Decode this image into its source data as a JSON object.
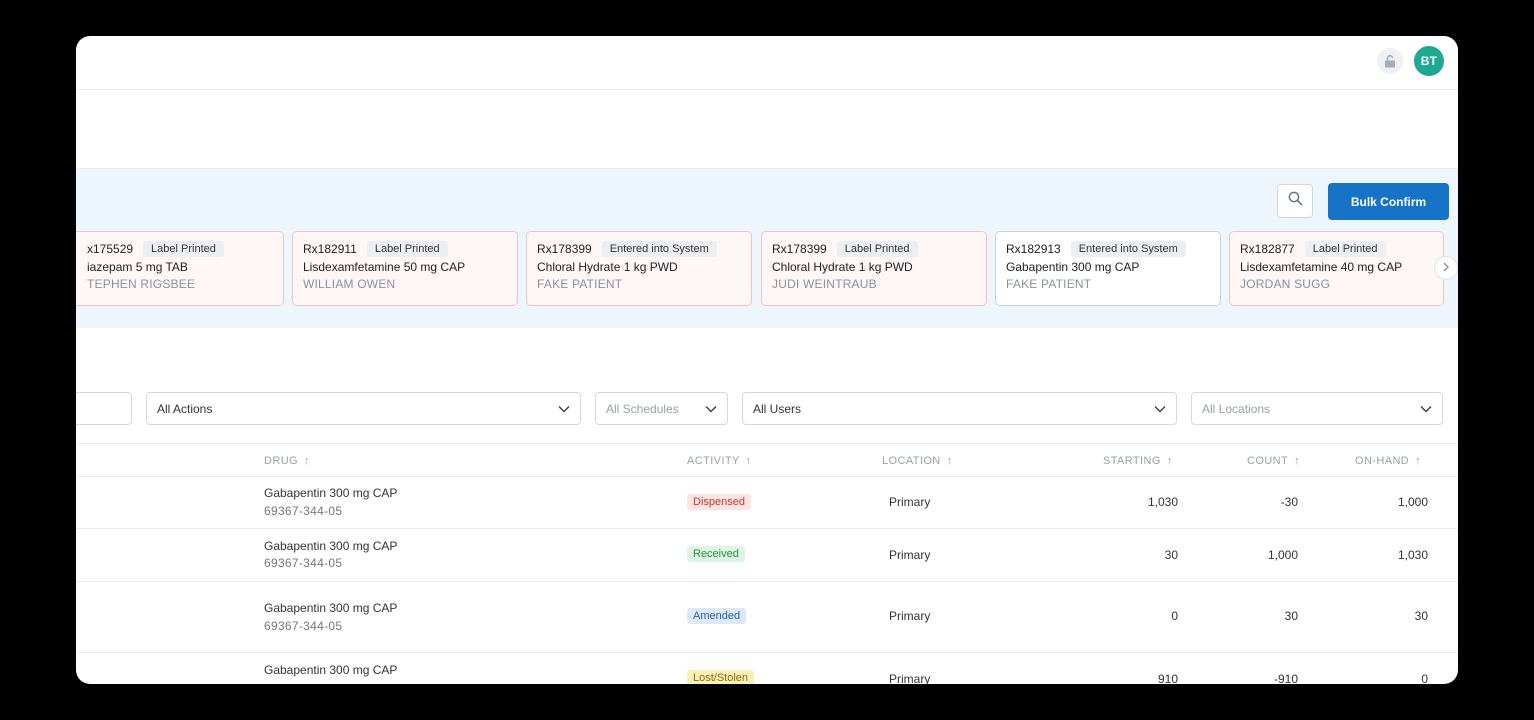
{
  "header": {
    "avatar_initials": "BT",
    "lock_icon": "lock-open-icon"
  },
  "banner": {
    "bulk_confirm_label": "Bulk Confirm",
    "search_icon": "search-icon",
    "cards": [
      {
        "rx": "x175529",
        "status": "Label Printed",
        "drug": "iazepam 5 mg TAB",
        "patient": "TEPHEN RIGSBEE",
        "style": "alert"
      },
      {
        "rx": "Rx182911",
        "status": "Label Printed",
        "drug": "Lisdexamfetamine 50 mg CAP",
        "patient": "WILLIAM OWEN",
        "style": "alert"
      },
      {
        "rx": "Rx178399",
        "status": "Entered into System",
        "drug": "Chloral Hydrate 1 kg PWD",
        "patient": "FAKE PATIENT",
        "style": "alert"
      },
      {
        "rx": "Rx178399",
        "status": "Label Printed",
        "drug": "Chloral Hydrate 1 kg PWD",
        "patient": "JUDI WEINTRAUB",
        "style": "alert"
      },
      {
        "rx": "Rx182913",
        "status": "Entered into System",
        "drug": "Gabapentin 300 mg CAP",
        "patient": "FAKE PATIENT",
        "style": "plain"
      },
      {
        "rx": "Rx182877",
        "status": "Label Printed",
        "drug": "Lisdexamfetamine 40 mg CAP",
        "patient": "JORDAN SUGG",
        "style": "alert"
      }
    ]
  },
  "filters": {
    "actions": "All Actions",
    "schedules": "All Schedules",
    "users": "All Users",
    "locations": "All Locations"
  },
  "table": {
    "columns": {
      "drug": "DRUG",
      "activity": "ACTIVITY",
      "location": "LOCATION",
      "starting": "STARTING",
      "count": "COUNT",
      "onhand": "ON-HAND",
      "sort_arrow": "↑"
    },
    "rows": [
      {
        "drug": "Gabapentin 300 mg CAP",
        "ndc": "69367-344-05",
        "activity": "Dispensed",
        "location": "Primary",
        "starting": "1,030",
        "count": "-30",
        "onhand": "1,000"
      },
      {
        "drug": "Gabapentin 300 mg CAP",
        "ndc": "69367-344-05",
        "activity": "Received",
        "location": "Primary",
        "starting": "30",
        "count": "1,000",
        "onhand": "1,030"
      },
      {
        "drug": "Gabapentin 300 mg CAP",
        "ndc": "69367-344-05",
        "activity": "Amended",
        "location": "Primary",
        "starting": "0",
        "count": "30",
        "onhand": "30"
      },
      {
        "drug": "Gabapentin 300 mg CAP",
        "ndc": "",
        "activity": "Lost/Stolen",
        "location": "Primary",
        "starting": "910",
        "count": "-910",
        "onhand": "0"
      }
    ]
  },
  "colors": {
    "primary": "#1673c6",
    "avatar": "#1fa892",
    "dispensed_bg": "#fde4e4",
    "dispensed_fg": "#c0392b",
    "received_bg": "#dff5e3",
    "received_fg": "#2e8b47",
    "amended_bg": "#dde9f8",
    "amended_fg": "#2c5fa0",
    "lost_bg": "#fbf0b8",
    "lost_fg": "#8a6d00"
  }
}
